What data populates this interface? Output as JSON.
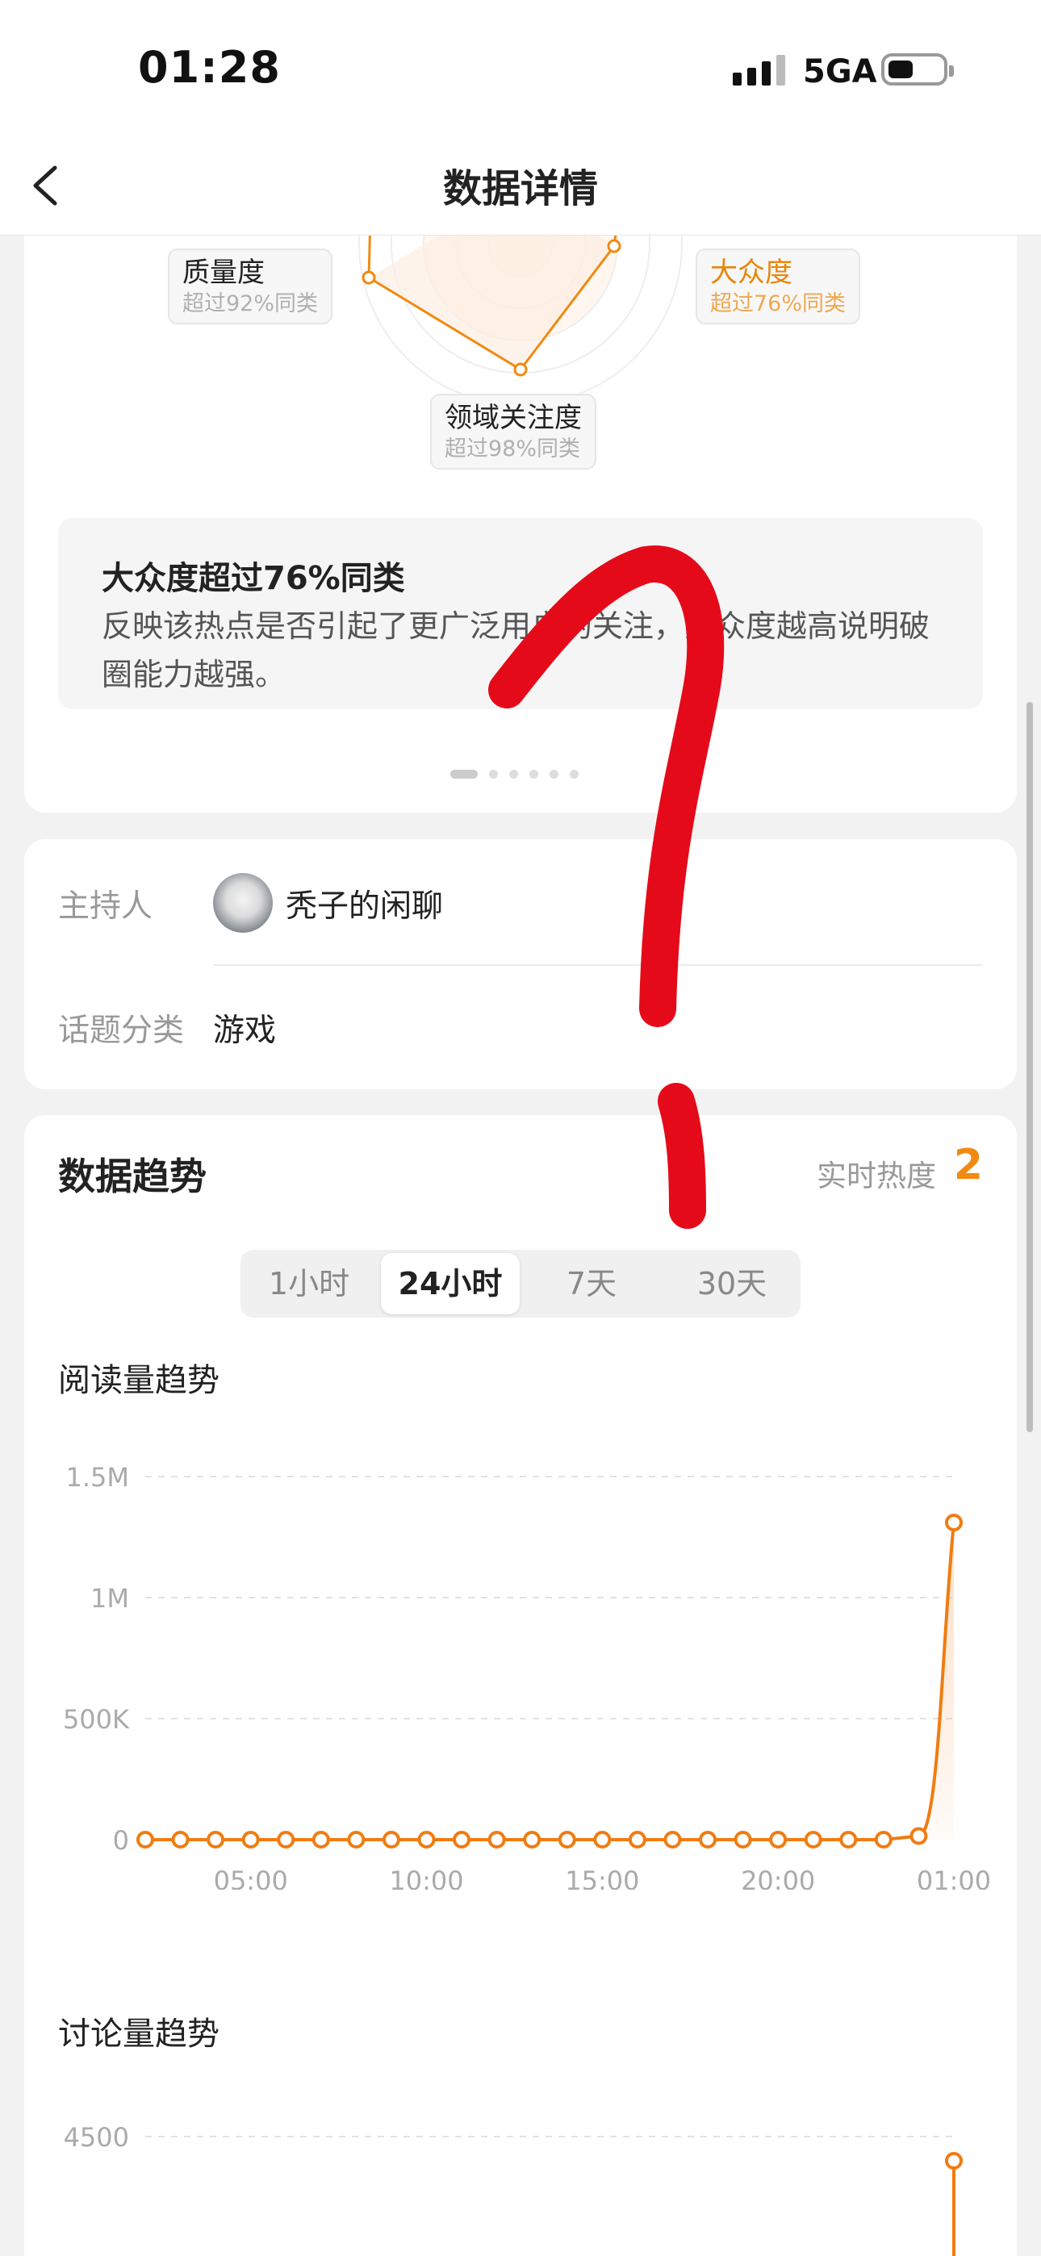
{
  "status": {
    "time": "01:28",
    "network": "5GA"
  },
  "nav": {
    "title": "数据详情"
  },
  "radar": {
    "axes": [
      {
        "name": "质量度",
        "desc": "超过92%同类",
        "value": 0.92
      },
      {
        "name": "大众度",
        "desc": "超过76%同类",
        "value": 0.76,
        "highlighted": true
      },
      {
        "name": "领域关注度",
        "desc": "超过98%同类",
        "value": 0.98
      }
    ]
  },
  "info": {
    "title": "大众度超过76%同类",
    "desc": "反映该热点是否引起了更广泛用户的关注，大众度越高说明破圈能力越强。"
  },
  "meta": {
    "host_label": "主持人",
    "host_name": "秃子的闲聊",
    "category_label": "话题分类",
    "category": "游戏"
  },
  "trend": {
    "title": "数据趋势",
    "heat_label": "实时热度",
    "heat_value": "2",
    "tabs": [
      "1小时",
      "24小时",
      "7天",
      "30天"
    ],
    "active_tab": "24小时"
  },
  "chart_data": [
    {
      "type": "line",
      "title": "阅读量趋势",
      "xlabel": "",
      "ylabel": "",
      "x_ticks": [
        "05:00",
        "10:00",
        "15:00",
        "20:00",
        "01:00"
      ],
      "y_ticks": [
        "0",
        "500K",
        "1M",
        "1.5M"
      ],
      "ylim": [
        0,
        1500000
      ],
      "grid": true,
      "color": "#f07c12",
      "series": [
        {
          "values": [
            0,
            0,
            0,
            0,
            0,
            0,
            0,
            0,
            0,
            0,
            0,
            0,
            0,
            0,
            0,
            0,
            0,
            0,
            0,
            0,
            0,
            0,
            15000,
            1310000
          ]
        }
      ]
    },
    {
      "type": "line",
      "title": "讨论量趋势",
      "xlabel": "",
      "ylabel": "",
      "y_ticks": [
        "4500"
      ],
      "grid": true,
      "color": "#f07c12",
      "series": [
        {
          "values": [
            4450
          ]
        }
      ]
    }
  ]
}
